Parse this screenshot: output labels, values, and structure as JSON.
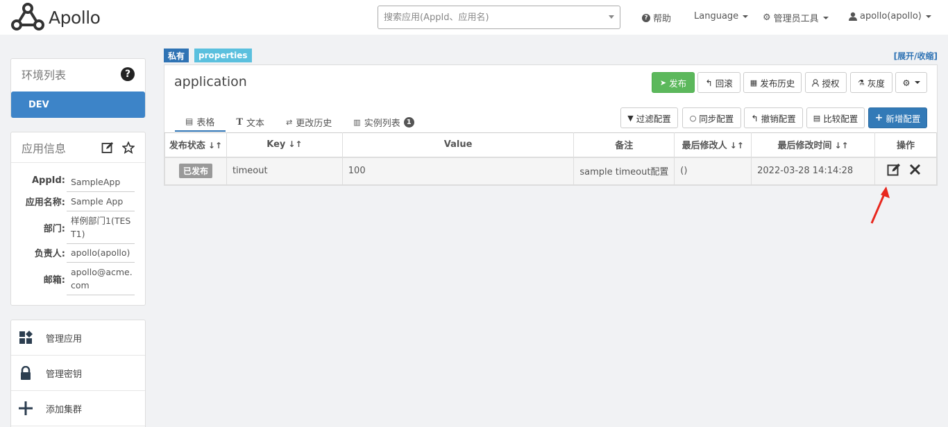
{
  "header": {
    "logo_text": "Apollo",
    "search_placeholder": "搜索应用(AppId、应用名)",
    "help": "帮助",
    "language": "Language",
    "admin_tools": "管理员工具",
    "user": "apollo(apollo)"
  },
  "sidebar": {
    "env_title": "环境列表",
    "env_dev": "DEV",
    "info_title": "应用信息",
    "info": [
      {
        "key": "AppId:",
        "value": "SampleApp"
      },
      {
        "key": "应用名称:",
        "value": "Sample App"
      },
      {
        "key": "部门:",
        "value": "样例部门1(TEST1)"
      },
      {
        "key": "负责人:",
        "value": "apollo(apollo)"
      },
      {
        "key": "邮箱:",
        "value": "apollo@acme.com"
      }
    ],
    "menu": [
      "管理应用",
      "管理密钥",
      "添加集群"
    ]
  },
  "main": {
    "tag_private": "私有",
    "tag_format": "properties",
    "expand_toggle": "[展开/收缩]",
    "namespace": "application",
    "buttons": {
      "publish": "发布",
      "rollback": "回滚",
      "history": "发布历史",
      "authorize": "授权",
      "gray": "灰度"
    },
    "tabs": [
      "表格",
      "文本",
      "更改历史",
      "实例列表"
    ],
    "instance_badge": "1",
    "actions": {
      "filter": "过滤配置",
      "sync": "同步配置",
      "revoke": "撤销配置",
      "compare": "比较配置",
      "add": "新增配置"
    },
    "table": {
      "headers": [
        "发布状态",
        "Key",
        "Value",
        "备注",
        "最后修改人",
        "最后修改时间",
        "操作"
      ],
      "rows": [
        {
          "status": "已发布",
          "key": "timeout",
          "value": "100",
          "comment": "sample timeout配置",
          "modifier": "()",
          "time": "2022-03-28 14:14:28"
        }
      ]
    }
  },
  "colors": {
    "primary": "#337ab7",
    "success": "#5cb85c",
    "info": "#5bc0de",
    "annotation": "#e8281e"
  }
}
